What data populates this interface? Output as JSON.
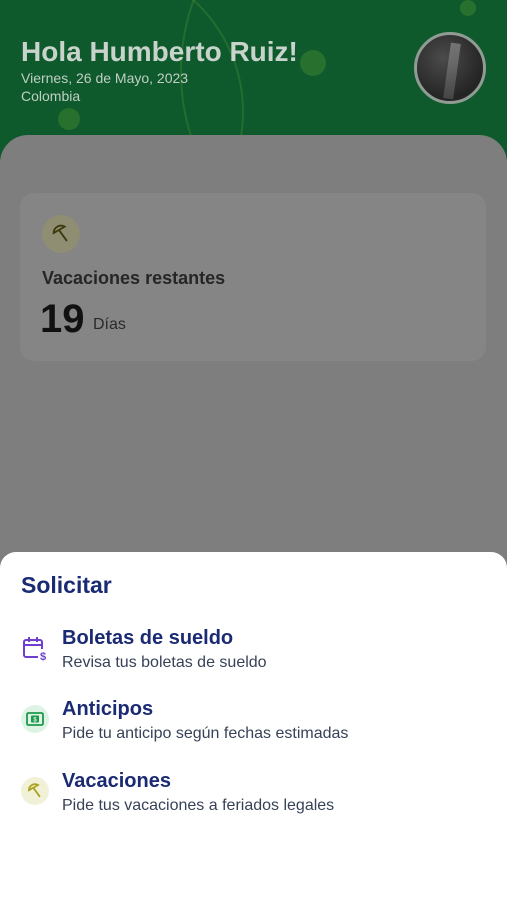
{
  "header": {
    "greeting": "Hola Humberto Ruiz!",
    "date": "Viernes, 26 de Mayo, 2023",
    "country": "Colombia",
    "avatar_icon": "profile-photo"
  },
  "vacation_card": {
    "icon": "umbrella-icon",
    "title": "Vacaciones restantes",
    "days_value": "19",
    "days_unit": "Días"
  },
  "sheet": {
    "title": "Solicitar",
    "items": [
      {
        "icon": "calendar-money-icon",
        "title": "Boletas de sueldo",
        "subtitle": "Revisa tus boletas de sueldo",
        "icon_color": "#6e3fd1"
      },
      {
        "icon": "cash-icon",
        "title": "Anticipos",
        "subtitle": "Pide tu anticipo según fechas estimadas",
        "icon_color": "#1b9a4c"
      },
      {
        "icon": "umbrella-icon",
        "title": "Vacaciones",
        "subtitle": "Pide tus vacaciones a feriados legales",
        "icon_color": "#a8a21c"
      }
    ]
  },
  "colors": {
    "header_green": "#0e5a2c",
    "title_navy": "#1a2a73",
    "overlay": "#7e7e7e"
  }
}
